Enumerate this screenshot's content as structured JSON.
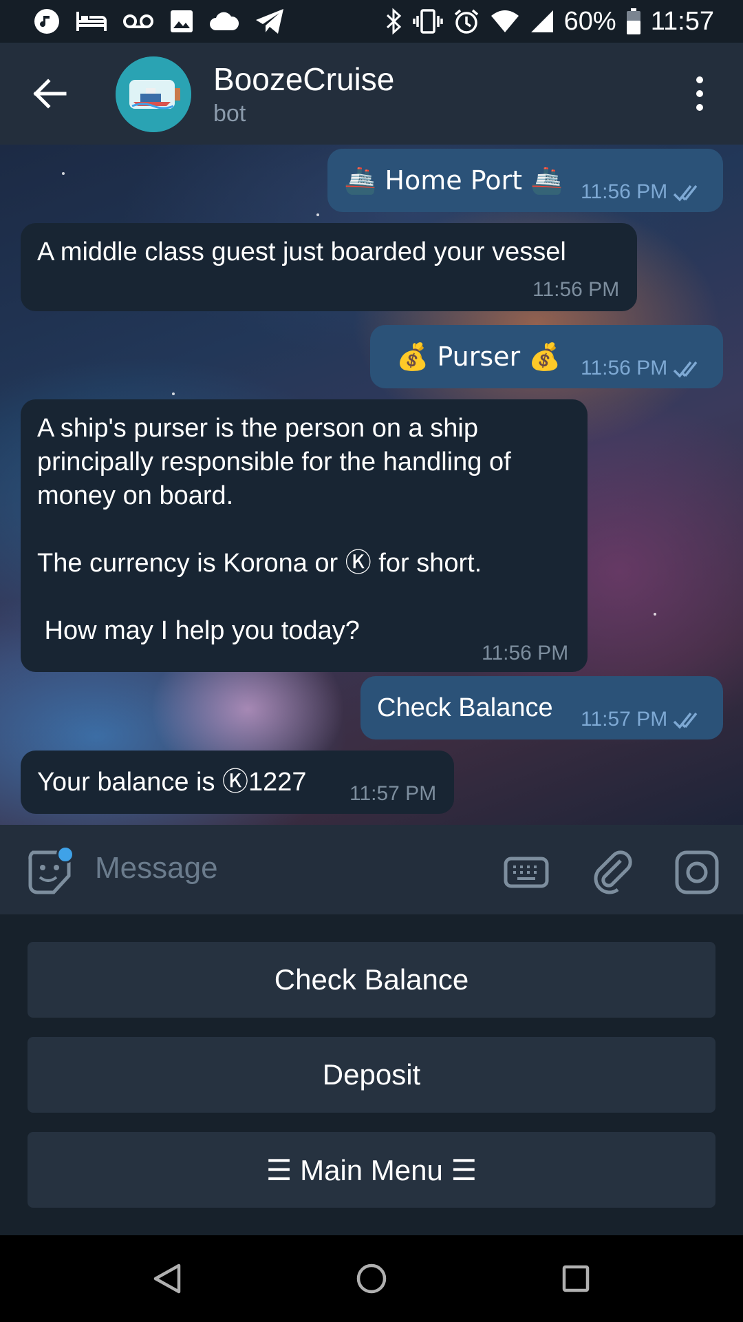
{
  "status_bar": {
    "battery": "60%",
    "time": "11:57"
  },
  "header": {
    "title": "BoozeCruise",
    "subtitle": "bot"
  },
  "messages": [
    {
      "direction": "out",
      "text": "🚢 Home Port 🚢",
      "time": "11:56 PM"
    },
    {
      "direction": "in",
      "text": "A middle class guest just boarded your vessel",
      "time": "11:56 PM"
    },
    {
      "direction": "out",
      "text": "💰 Purser 💰",
      "time": "11:56 PM"
    },
    {
      "direction": "in",
      "lines": [
        "A ship's purser is the person on a ship",
        "principally responsible for the handling of",
        "money on board.",
        "",
        "The currency is Korona or Ⓚ for short.",
        "",
        " How may I help you today?"
      ],
      "time": "11:56 PM"
    },
    {
      "direction": "out",
      "text": "Check Balance",
      "time": "11:57 PM"
    },
    {
      "direction": "in",
      "text": "Your balance is Ⓚ1227",
      "time": "11:57 PM"
    }
  ],
  "input": {
    "placeholder": "Message"
  },
  "keyboard_buttons": [
    "Check Balance",
    "Deposit",
    "☰ Main Menu ☰"
  ],
  "colors": {
    "header_bg": "#232e3c",
    "outgoing_bubble": "#2b5278",
    "incoming_bubble": "#182533",
    "accent": "#3fa2e8",
    "keyboard_button": "#263240"
  }
}
